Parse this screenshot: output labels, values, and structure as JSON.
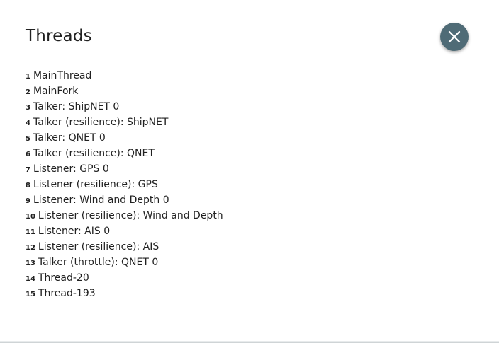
{
  "dialog": {
    "title": "Threads",
    "close_icon": "close-icon"
  },
  "threads": [
    {
      "num": "1",
      "name": "MainThread"
    },
    {
      "num": "2",
      "name": "MainFork"
    },
    {
      "num": "3",
      "name": "Talker: ShipNET 0"
    },
    {
      "num": "4",
      "name": "Talker (resilience): ShipNET"
    },
    {
      "num": "5",
      "name": "Talker: QNET 0"
    },
    {
      "num": "6",
      "name": "Talker (resilience): QNET"
    },
    {
      "num": "7",
      "name": "Listener: GPS 0"
    },
    {
      "num": "8",
      "name": "Listener (resilience): GPS"
    },
    {
      "num": "9",
      "name": "Listener: Wind and Depth 0"
    },
    {
      "num": "10",
      "name": "Listener (resilience): Wind and Depth"
    },
    {
      "num": "11",
      "name": "Listener: AIS 0"
    },
    {
      "num": "12",
      "name": "Listener (resilience): AIS"
    },
    {
      "num": "13",
      "name": "Talker (throttle): QNET 0"
    },
    {
      "num": "14",
      "name": "Thread-20"
    },
    {
      "num": "15",
      "name": "Thread-193"
    }
  ],
  "colors": {
    "close_button_bg": "#4f6b76",
    "text": "#212121"
  }
}
